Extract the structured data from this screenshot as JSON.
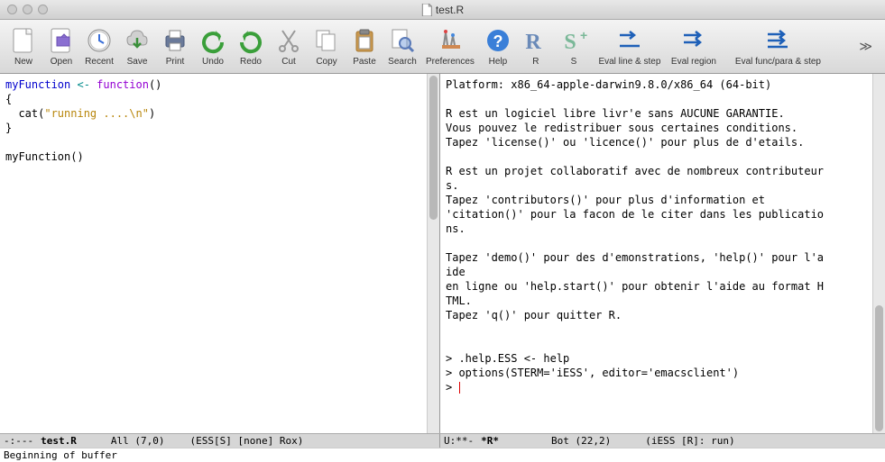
{
  "window": {
    "title": "test.R"
  },
  "toolbar": {
    "new": "New",
    "open": "Open",
    "recent": "Recent",
    "save": "Save",
    "print": "Print",
    "undo": "Undo",
    "redo": "Redo",
    "cut": "Cut",
    "copy": "Copy",
    "paste": "Paste",
    "search": "Search",
    "preferences": "Preferences",
    "help": "Help",
    "r": "R",
    "s": "S",
    "eval_line": "Eval line & step",
    "eval_region": "Eval region",
    "eval_func": "Eval func/para & step"
  },
  "left_pane": {
    "code": {
      "l1a": "myFunction",
      "l1b": " <- ",
      "l1c": "function",
      "l1d": "()",
      "l2": "{",
      "l3a": "  cat(",
      "l3b": "\"running ....\\n\"",
      "l3c": ")",
      "l4": "}",
      "l5": "",
      "l6": "myFunction()"
    },
    "modeline": {
      "prefix": "-:---",
      "buffer": "test.R",
      "pos": "All (7,0)",
      "modes": "(ESS[S] [none] Rox)"
    }
  },
  "right_pane": {
    "lines": [
      "Platform: x86_64-apple-darwin9.8.0/x86_64 (64-bit)",
      "",
      "R est un logiciel libre livr'e sans AUCUNE GARANTIE.",
      "Vous pouvez le redistribuer sous certaines conditions.",
      "Tapez 'license()' ou 'licence()' pour plus de d'etails.",
      "",
      "R est un projet collaboratif avec de nombreux contributeur",
      "s.",
      "Tapez 'contributors()' pour plus d'information et",
      "'citation()' pour la facon de le citer dans les publicatio",
      "ns.",
      "",
      "Tapez 'demo()' pour des d'emonstrations, 'help()' pour l'a",
      "ide",
      "en ligne ou 'help.start()' pour obtenir l'aide au format H",
      "TML.",
      "Tapez 'q()' pour quitter R.",
      "",
      "",
      "> .help.ESS <- help",
      "> options(STERM='iESS', editor='emacsclient')",
      "> "
    ],
    "modeline": {
      "prefix": "U:**-",
      "buffer": "*R*",
      "pos": "Bot (22,2)",
      "modes": "(iESS [R]: run)"
    }
  },
  "minibuffer": "Beginning of buffer"
}
